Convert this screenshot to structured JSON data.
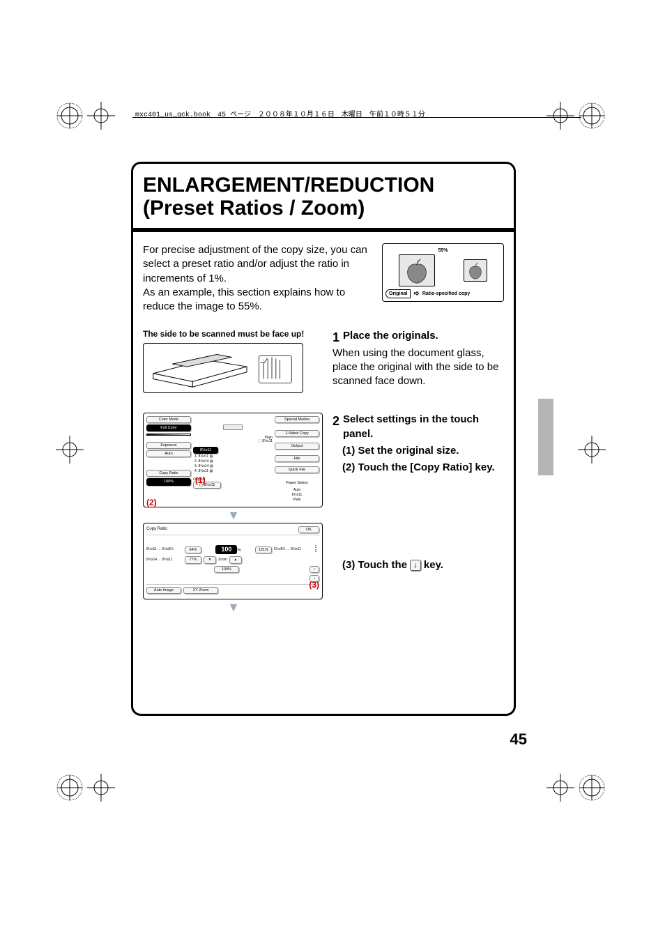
{
  "header": {
    "meta_line": "mxc401_us_qck.book　45 ページ　２００８年１０月１６日　木曜日　午前１０時５１分"
  },
  "title": "ENLARGEMENT/REDUCTION (Preset Ratios / Zoom)",
  "intro": {
    "text1": "For precise adjustment of the copy size, you can select a preset ratio and/or adjust the ratio in increments of 1%.",
    "text2": "As an example, this section explains how to reduce the image to 55%.",
    "percent_label": "55%",
    "original_label": "Original",
    "ratio_copy_label": "Ratio-specified copy"
  },
  "step1": {
    "num": "1",
    "title": "Place the originals.",
    "body": "When using the document glass, place the original with the side to be scanned face down.",
    "faceup_caption": "The side to be scanned must be face up!"
  },
  "step2": {
    "num": "2",
    "title": "Select settings in the touch panel.",
    "sub1": "(1) Set the original size.",
    "sub2": "(2) Touch the [Copy Ratio] key.",
    "sub3_a": "(3) Touch the ",
    "sub3_b": " key."
  },
  "panel1": {
    "color_mode": "Color Mode",
    "full_color": "Full Color",
    "exposure": "Exposure",
    "auto": "Auto",
    "copy_ratio": "Copy Ratio",
    "ratio_100": "100%",
    "special_modes": "Special Modes",
    "two_sided": "2-Sided Copy",
    "output": "Output",
    "file": "File",
    "quick_file": "Quick File",
    "paper_select": "Paper Select",
    "original": "Original",
    "original_btn": "8½x11",
    "plain": "Plain",
    "paper_sizes_1": "8½x11",
    "paper_sizes_2": "8½x14",
    "paper_sizes_3": "8½x14",
    "paper_sizes_4": "8½x11",
    "paper_auto": "Auto",
    "paper_8x11": "8½x11",
    "paper_plain": "Plain",
    "callout1": "(1)",
    "callout2": "(2)"
  },
  "panel2": {
    "title": "Copy Ratio",
    "ok": "OK",
    "percent100": "100",
    "pct_suffix": "%",
    "r1_label": "8½x11 → 5½x8½",
    "r1_btn": "64%",
    "r2_label": "8½x14 → 8½x11",
    "r2_btn": "77%",
    "e1_btn": "121%",
    "e1_label": "5½x8½ → 8½x11",
    "one_hundred": "100%",
    "zoom": "Zoom",
    "auto_image": "Auto Image",
    "xy_zoom": "XY Zoom",
    "page_ind_1": "1",
    "page_ind_2": "2",
    "up_key": "↑",
    "down_key": "↓",
    "callout3": "(3)"
  },
  "page_number": "45",
  "inline_down_key": "↓"
}
